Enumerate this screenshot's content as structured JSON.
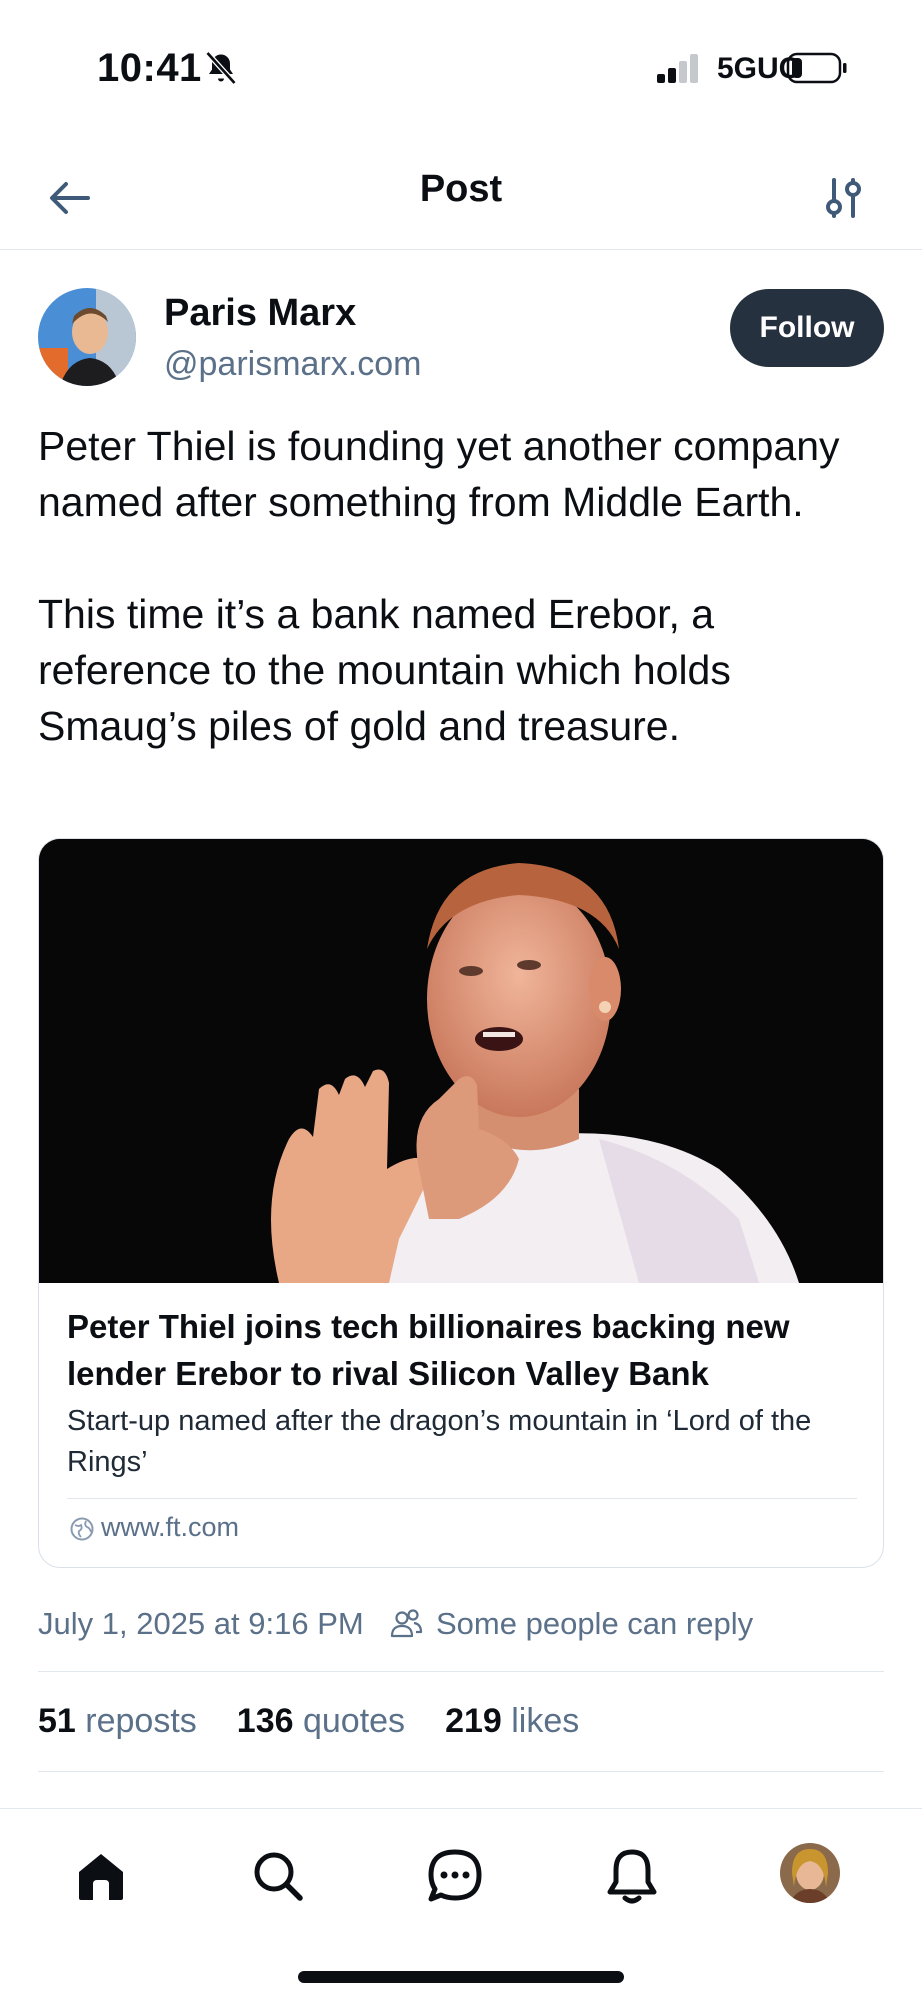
{
  "status_bar": {
    "time": "10:41",
    "network": "5GUC",
    "icons": [
      "bell-off-icon",
      "signal-icon",
      "battery-icon"
    ]
  },
  "header": {
    "title": "Post",
    "back_icon": "arrow-left-icon",
    "settings_icon": "sliders-icon"
  },
  "author": {
    "name": "Paris Marx",
    "handle": "@parismarx.com",
    "follow_label": "Follow"
  },
  "post": {
    "text": "Peter Thiel is founding yet another company named after something from Middle Earth.\n\nThis time it’s a bank named Erebor, a reference to the mountain which holds Smaug’s piles of gold and treasure."
  },
  "link_card": {
    "title": "Peter Thiel joins tech billionaires backing new lender Erebor to rival Silicon Valley Bank",
    "description": "Start-up named after the dragon’s mountain in ‘Lord of the Rings’",
    "domain": "www.ft.com"
  },
  "meta": {
    "date": "July 1, 2025 at 9:16 PM",
    "reply_setting": "Some people can reply"
  },
  "stats": [
    {
      "count": "51",
      "label": "reposts"
    },
    {
      "count": "136",
      "label": "quotes"
    },
    {
      "count": "219",
      "label": "likes"
    }
  ],
  "colors": {
    "accent_dark": "#25313f",
    "secondary_text": "#5b7089",
    "primary_text": "#0b0f14",
    "divider": "#e3e8ee"
  },
  "bottom_nav": {
    "items": [
      "home-icon",
      "search-icon",
      "chat-icon",
      "notifications-icon",
      "profile-avatar"
    ]
  }
}
